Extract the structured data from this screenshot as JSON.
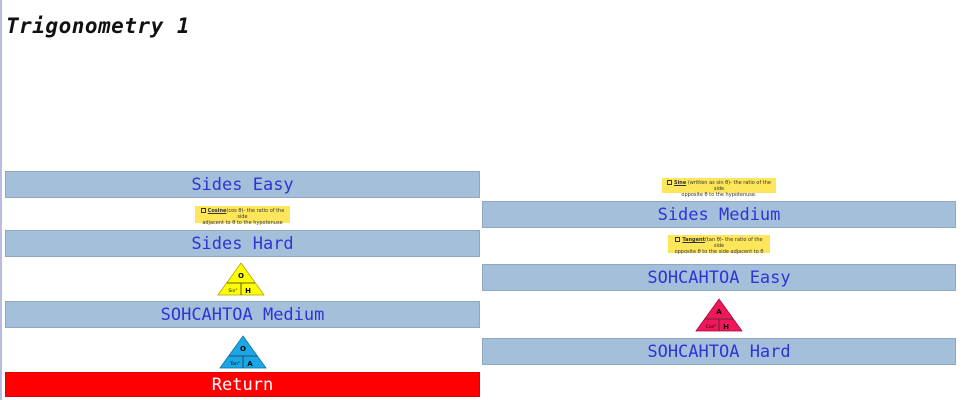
{
  "page": {
    "title": "Trigonometry 1"
  },
  "buttons": {
    "sides_easy": "Sides Easy",
    "sides_hard": "Sides Hard",
    "sohcahtoa_medium": "SOHCAHTOA Medium",
    "return": "Return",
    "sides_medium": "Sides Medium",
    "sohcahtoa_easy": "SOHCAHTOA Easy",
    "sohcahtoa_hard": "SOHCAHTOA Hard"
  },
  "notes": {
    "cosine": {
      "term": "Cosine",
      "text1": "(cos θ)- the ratio of the side",
      "text2": "adjacent to θ to the hypotenuse"
    },
    "sine": {
      "term": "Sine",
      "text1": " (written as sin θ)- the ratio of the side",
      "text2": "opposite θ to the hypotenuse."
    },
    "tangent": {
      "term": "Tangent",
      "text1": "(tan θ)- the ratio of the side",
      "text2": "opposite θ to the side adjacent to θ"
    }
  },
  "triangles": {
    "sin": {
      "top": "O",
      "left": "Sin°",
      "right": "H",
      "color": "#ffff00"
    },
    "tan": {
      "top": "O",
      "left": "Tan°",
      "right": "A",
      "color": "#1aa7e8"
    },
    "cos": {
      "top": "A",
      "left": "Cos°",
      "right": "H",
      "color": "#f0185a"
    }
  }
}
